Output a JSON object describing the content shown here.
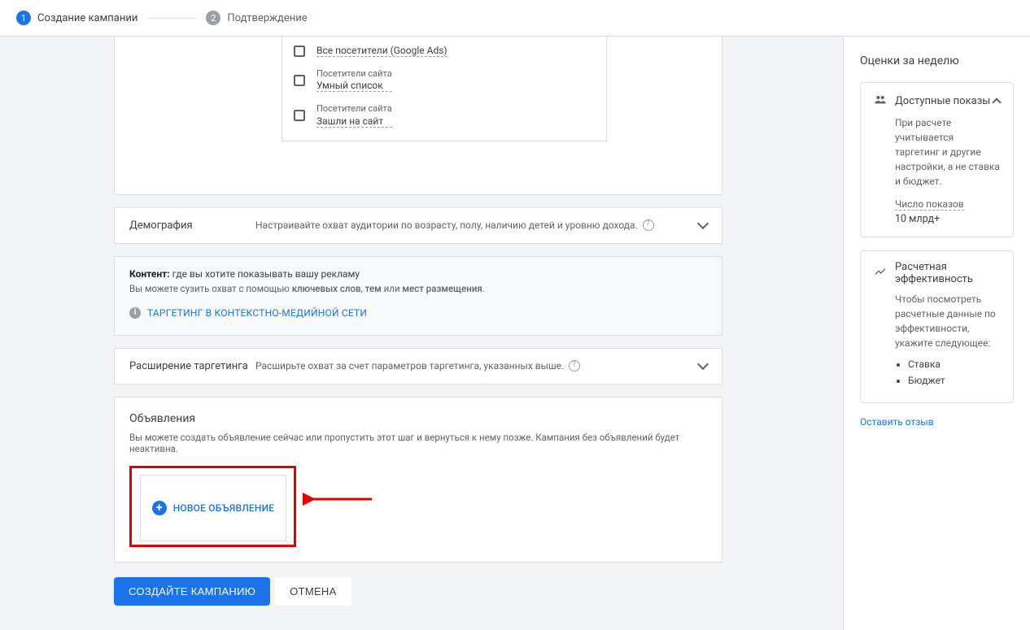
{
  "stepper": {
    "steps": [
      {
        "num": "1",
        "label": "Создание кампании"
      },
      {
        "num": "2",
        "label": "Подтверждение"
      }
    ]
  },
  "audiences": {
    "items": [
      {
        "category": "",
        "name": "Все посетители (Google Ads)"
      },
      {
        "category": "Посетители сайта",
        "name": "Умный список"
      },
      {
        "category": "Посетители сайта",
        "name": "Зашли на сайт"
      }
    ]
  },
  "demography": {
    "label": "Демография",
    "desc": "Настраивайте охват аудитории по возрасту, полу, наличию детей и уровню дохода."
  },
  "content": {
    "title_bold": "Контент:",
    "title_rest": " где вы хотите показывать вашу рекламу",
    "sub_prefix": "Вы можете сузить охват с помощью ",
    "sub_kw": "ключевых слов",
    "sub_sep1": ", ",
    "sub_themes": "тем",
    "sub_sep2": " или ",
    "sub_placements": "мест размещения",
    "sub_dot": ".",
    "link": "ТАРГЕТИНГ В КОНТЕКСТНО-МЕДИЙНОЙ СЕТИ"
  },
  "expansion": {
    "label": "Расширение таргетинга",
    "desc": "Расширьте охват за счет параметров таргетинга, указанных выше."
  },
  "ads": {
    "title": "Объявления",
    "desc": "Вы можете создать объявление сейчас или пропустить этот шаг и вернуться к нему позже. Кампания без объявлений будет неактивна.",
    "new_ad": "НОВОЕ ОБЪЯВЛЕНИЕ"
  },
  "buttons": {
    "create": "СОЗДАЙТЕ КАМПАНИЮ",
    "cancel": "ОТМЕНА"
  },
  "side": {
    "title": "Оценки за неделю",
    "impressions": {
      "header": "Доступные показы",
      "body": "При расчете учитывается таргетинг и другие настройки, а не ставка и бюджет.",
      "metric_label": "Число показов",
      "metric_value": "10 млрд+"
    },
    "performance": {
      "header": "Расчетная эффективность",
      "body": "Чтобы посмотреть расчетные данные по эффективности, укажите следующее:",
      "items": [
        "Ставка",
        "Бюджет"
      ]
    },
    "feedback": "Оставить отзыв"
  }
}
